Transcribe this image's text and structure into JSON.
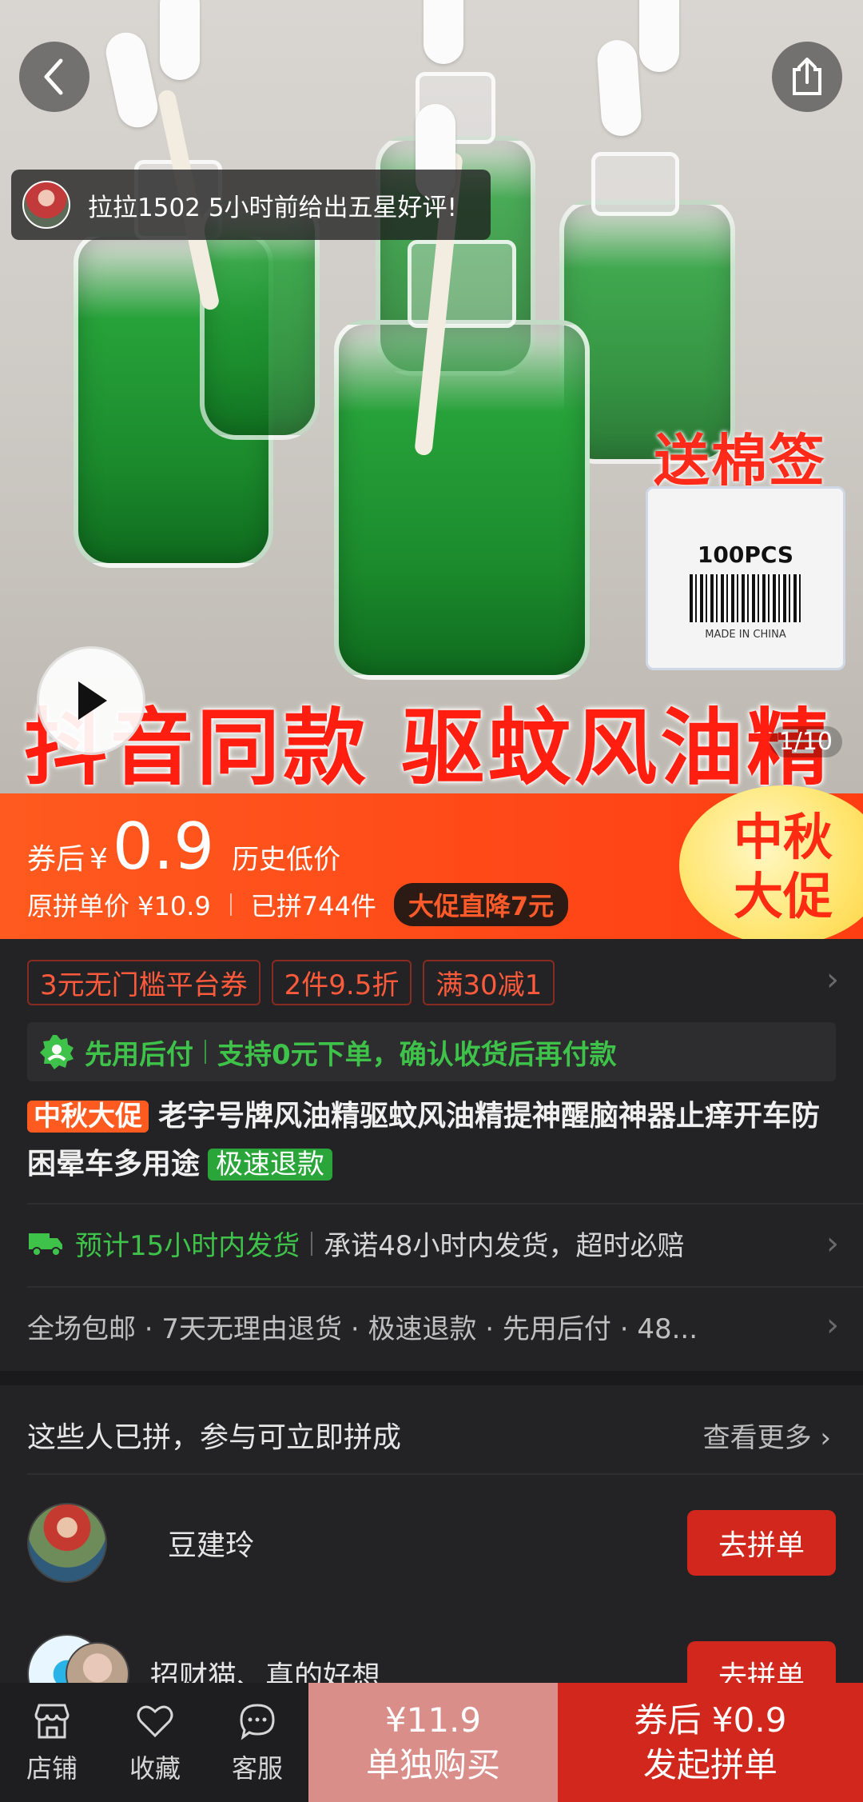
{
  "hero": {
    "review_user": "拉拉1502",
    "review_text": "拉拉1502 5小时前给出五星好评!",
    "gift_text": "送棉签",
    "box_pcs": "100PCS",
    "box_madein": "MADE IN CHINA",
    "banner_text": "抖音同款 驱蚊风油精",
    "pager": "1/10"
  },
  "price": {
    "coupon_label": "券后",
    "yen": "¥",
    "after_coupon": "0.9",
    "low_tag": "历史低价",
    "original_label": "原拼单价 ¥10.9",
    "sold": "已拼744件",
    "promo": "大促直降7元",
    "moon_line1": "中秋",
    "moon_line2": "大促"
  },
  "coupons": [
    "3元无门槛平台券",
    "2件9.5折",
    "满30减1"
  ],
  "pay_later": {
    "title": "先用后付",
    "desc": "支持0元下单，确认收货后再付款"
  },
  "product": {
    "tag": "中秋大促",
    "title": "老字号牌风油精驱蚊风油精提神醒脑神器止痒开车防困晕车多用途",
    "badge": "极速退款"
  },
  "shipping": {
    "eta": "预计15小时内发货",
    "promise": "承诺48小时内发货，超时必赔"
  },
  "guarantee": "全场包邮 · 7天无理由退货 · 极速退款 · 先用后付 · 48...",
  "group": {
    "heading": "这些人已拼，参与可立即拼成",
    "see_more": "查看更多",
    "members": [
      {
        "name": "豆建玲",
        "button": "去拼单"
      },
      {
        "name": "招财猫、真的好想",
        "button": "去拼单"
      }
    ]
  },
  "bottom_bar": {
    "store": "店铺",
    "favorite": "收藏",
    "service": "客服",
    "solo_price": "¥11.9",
    "solo_label": "单独购买",
    "group_price": "券后 ¥0.9",
    "group_label": "发起拼单"
  }
}
